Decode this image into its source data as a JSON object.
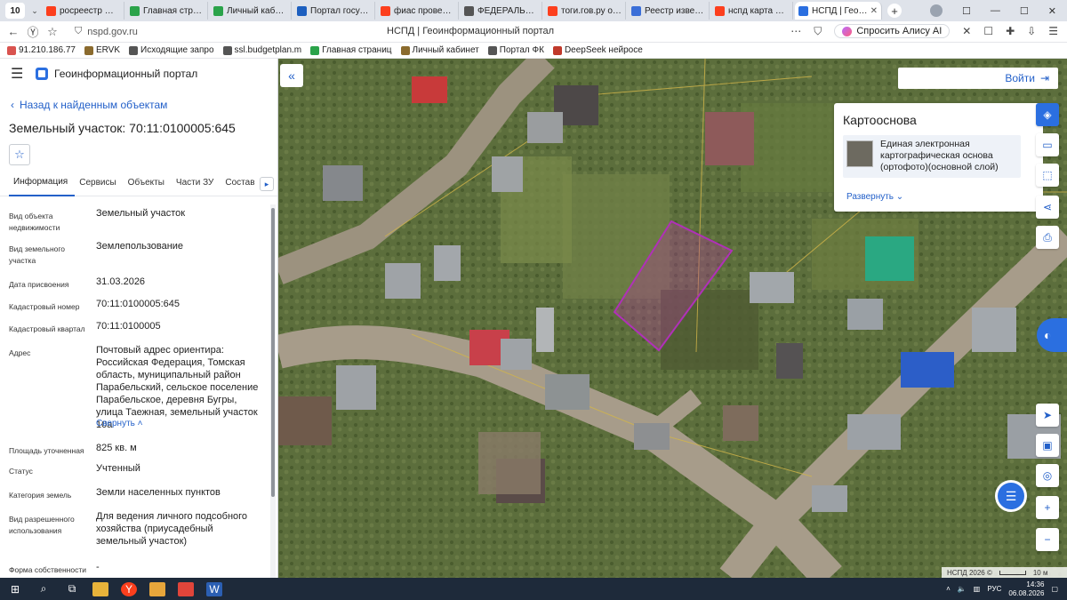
{
  "browser": {
    "tab_counter": "10",
    "tabs": [
      {
        "label": "росреестр — Янд",
        "color": "#fc3f1d",
        "active": false
      },
      {
        "label": "Главная страниц",
        "color": "#2ba34a",
        "active": false
      },
      {
        "label": "Личный кабинет",
        "color": "#2ba34a",
        "active": false
      },
      {
        "label": "Портал государст",
        "color": "#1d5fbf",
        "active": false
      },
      {
        "label": "фиас проверка ад",
        "color": "#fc3f1d",
        "active": false
      },
      {
        "label": "ФЕДЕРАЛЬНАЯ И",
        "color": "#555555",
        "active": false
      },
      {
        "label": "тоги.гов.ру офиц",
        "color": "#fc3f1d",
        "active": false
      },
      {
        "label": "Реестр извещени",
        "color": "#3b6fd8",
        "active": false
      },
      {
        "label": "нспд карта публи",
        "color": "#fc3f1d",
        "active": false
      },
      {
        "label": "НСПД | Геоинф",
        "color": "#2b6fe0",
        "active": true
      }
    ],
    "url": "nspd.gov.ru",
    "page_title": "НСПД | Геоинформационный портал",
    "alisa_label": "Спросить Алису AI",
    "bookmarks": [
      {
        "label": "91.210.186.77",
        "color": "#d9534f"
      },
      {
        "label": "ERVK",
        "color": "#8b6b2e"
      },
      {
        "label": "Исходящие запро",
        "color": "#555555"
      },
      {
        "label": "ssl.budgetplan.m",
        "color": "#555555"
      },
      {
        "label": "Главная страниц",
        "color": "#2ba34a"
      },
      {
        "label": "Личный кабинет",
        "color": "#8b6b2e"
      },
      {
        "label": "Портал ФК",
        "color": "#555555"
      },
      {
        "label": "DeepSeek нейросе",
        "color": "#c0392b"
      }
    ]
  },
  "panel": {
    "portal_name": "Геоинформационный портал",
    "back_label": "Назад к найденным объектам",
    "object_title": "Земельный участок: 70:11:0100005:645",
    "tabs": [
      "Информация",
      "Сервисы",
      "Объекты",
      "Части ЗУ",
      "Состав"
    ],
    "properties": [
      {
        "label": "Вид объекта недвижимости",
        "value": "Земельный участок"
      },
      {
        "label": "Вид земельного участка",
        "value": "Землепользование"
      },
      {
        "label": "Дата присвоения",
        "value": "31.03.2026"
      },
      {
        "label": "Кадастровый номер",
        "value": "70:11:0100005:645"
      },
      {
        "label": "Кадастровый квартал",
        "value": "70:11:0100005"
      },
      {
        "label": "Адрес",
        "value": "Почтовый адрес ориентира: Российская Федерация, Томская область, муниципальный район Парабельский, сельское поселение Парабельское, деревня Бугры, улица Таежная, земельный участок 10а"
      },
      {
        "label": "Площадь уточненная",
        "value": "825 кв. м"
      },
      {
        "label": "Статус",
        "value": "Учтенный"
      },
      {
        "label": "Категория земель",
        "value": "Земли населенных пунктов"
      },
      {
        "label": "Вид разрешенного использования",
        "value": "Для ведения личного подсобного хозяйства (приусадебный земельный участок)"
      },
      {
        "label": "Форма собственности",
        "value": "-"
      }
    ],
    "collapse_label": "Свернуть"
  },
  "map": {
    "login_label": "Войти",
    "basemap_title": "Картооснова",
    "basemap_item": "Единая электронная картографическая основа (ортофото)(основной слой)",
    "expand_label": "Развернуть",
    "footer_label": "НСПД 2026 ©",
    "scale_label": "10 м"
  },
  "taskbar": {
    "lang": "РУС",
    "time": "14:36",
    "date": "06.08.2026"
  }
}
